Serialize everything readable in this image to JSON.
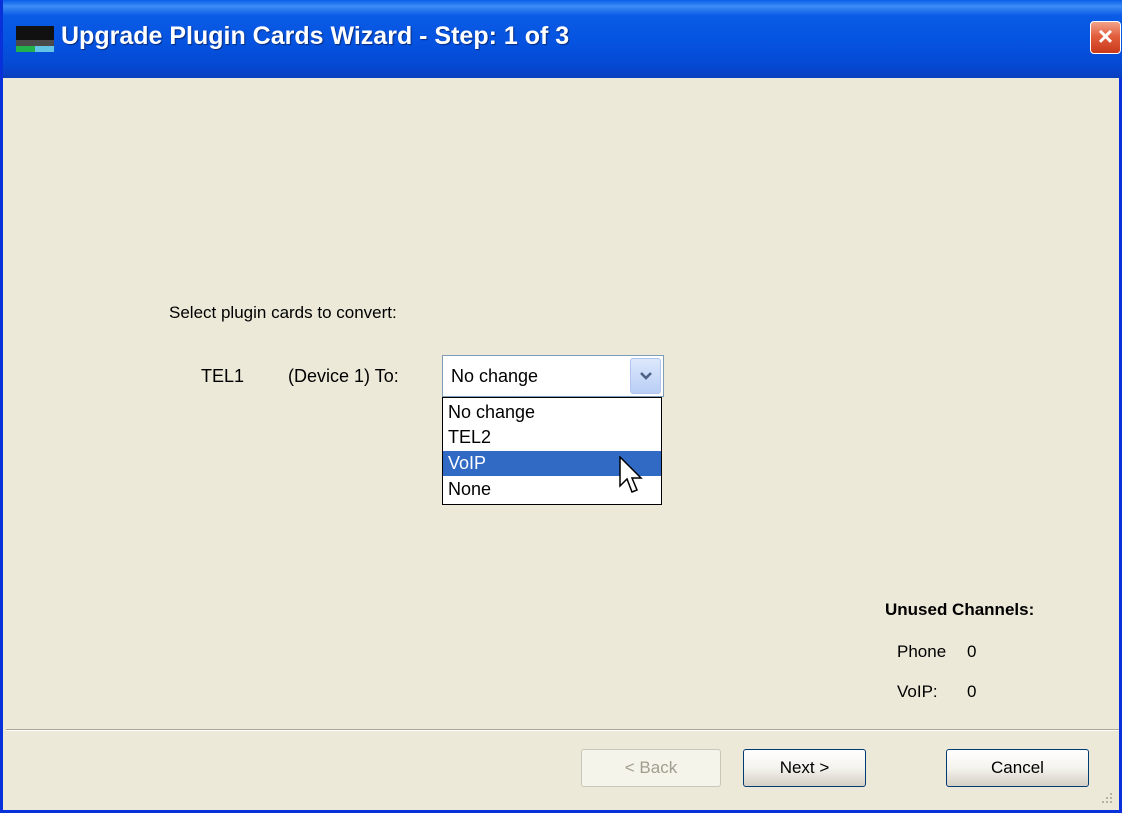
{
  "window": {
    "title": "Upgrade Plugin Cards Wizard - Step: 1 of 3",
    "close_label": "×"
  },
  "content": {
    "instruction": "Select plugin cards to convert:",
    "card_name": "TEL1",
    "device_label": "(Device 1) To:",
    "combo_value": "No change",
    "options": [
      {
        "label": "No change",
        "selected": false
      },
      {
        "label": "TEL2",
        "selected": false
      },
      {
        "label": "VoIP",
        "selected": true
      },
      {
        "label": "None",
        "selected": false
      }
    ]
  },
  "unused": {
    "title": "Unused Channels:",
    "phone_label": "Phone",
    "phone_value": "0",
    "voip_label": "VoIP:",
    "voip_value": "0"
  },
  "buttons": {
    "back": "< Back",
    "next": "Next >",
    "cancel": "Cancel"
  },
  "colors": {
    "titlebar": "#0553E0",
    "face": "#ECE9D8",
    "selection": "#316AC5"
  }
}
